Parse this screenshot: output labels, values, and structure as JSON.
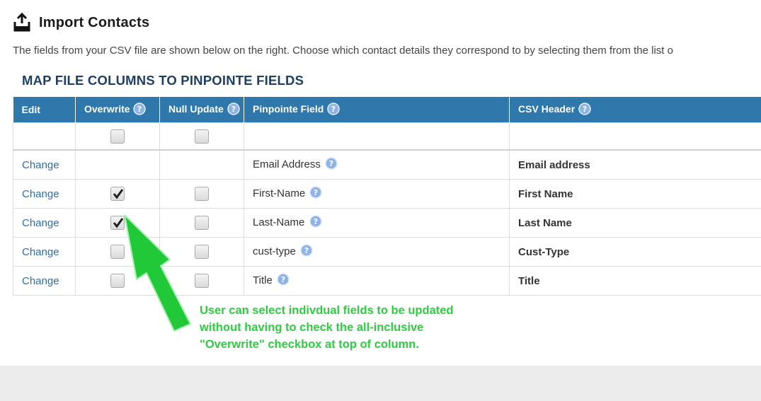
{
  "page": {
    "title": "Import Contacts",
    "description": "The fields from your CSV file are shown below on the right. Choose which contact details they correspond to by selecting them from the list o",
    "section_title": "MAP FILE COLUMNS TO PINPOINTE FIELDS"
  },
  "table": {
    "headers": {
      "edit": "Edit",
      "overwrite": "Overwrite",
      "null_update": "Null Update",
      "pinpointe_field": "Pinpointe Field",
      "csv_header": "CSV Header"
    },
    "master_row": {
      "overwrite_all_checked": false,
      "null_update_all_checked": false
    },
    "rows": [
      {
        "edit": "Change",
        "field": "Email Address",
        "csv": "Email address",
        "overwrite": null,
        "null_update": null
      },
      {
        "edit": "Change",
        "field": "First-Name",
        "csv": "First Name",
        "overwrite": true,
        "null_update": false
      },
      {
        "edit": "Change",
        "field": "Last-Name",
        "csv": "Last Name",
        "overwrite": true,
        "null_update": false
      },
      {
        "edit": "Change",
        "field": "cust-type",
        "csv": "Cust-Type",
        "overwrite": false,
        "null_update": false
      },
      {
        "edit": "Change",
        "field": "Title",
        "csv": "Title",
        "overwrite": false,
        "null_update": false
      }
    ]
  },
  "annotation": {
    "text": "User can select indivdual fields to be updated without having to check the all-inclusive \"Overwrite\" checkbox at top of column.",
    "color": "#2ecc40"
  },
  "colors": {
    "header_bg": "#2e78ab",
    "section_title": "#1e3f66",
    "link": "#2e6da4"
  },
  "icons": {
    "page": "import-tray-icon",
    "help": "help-question-icon",
    "check": "checkmark-icon"
  }
}
